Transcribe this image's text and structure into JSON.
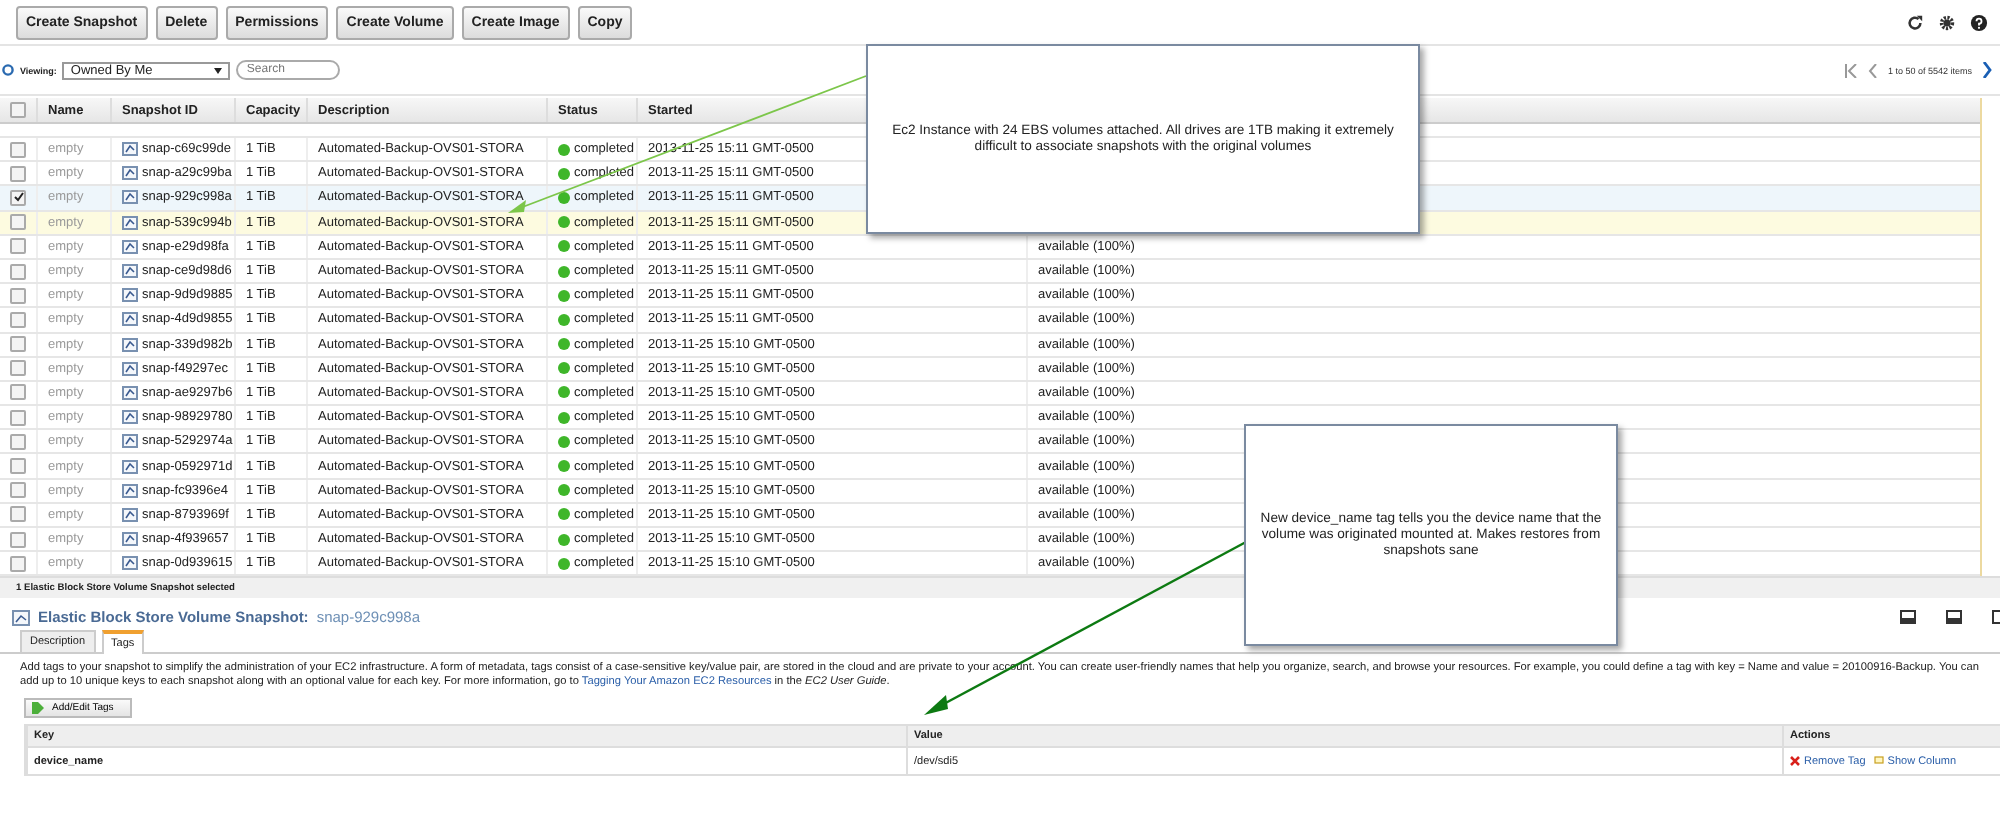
{
  "toolbar": {
    "buttons": [
      "Create Snapshot",
      "Delete",
      "Permissions",
      "Create Volume",
      "Create Image",
      "Copy"
    ]
  },
  "filter": {
    "label": "Viewing:",
    "value": "Owned By Me",
    "search_placeholder": "Search"
  },
  "pagination": {
    "text": "1 to 50 of 5542 items"
  },
  "table": {
    "all_checked": false,
    "columns": [
      "Name",
      "Snapshot ID",
      "Capacity",
      "Description",
      "Status",
      "Started"
    ],
    "rows": [
      {
        "checked": false,
        "hovered": false,
        "name": "empty",
        "id": "snap-c69c99de",
        "capacity": "1 TiB",
        "description": "Automated-Backup-OVS01-STORA",
        "status": "completed",
        "started": "2013-11-25 15:11 GMT-0500"
      },
      {
        "checked": false,
        "hovered": false,
        "name": "empty",
        "id": "snap-a29c99ba",
        "capacity": "1 TiB",
        "description": "Automated-Backup-OVS01-STORA",
        "status": "completed",
        "started": "2013-11-25 15:11 GMT-0500"
      },
      {
        "checked": true,
        "hovered": false,
        "name": "empty",
        "id": "snap-929c998a",
        "capacity": "1 TiB",
        "description": "Automated-Backup-OVS01-STORA",
        "status": "completed",
        "started": "2013-11-25 15:11 GMT-0500"
      },
      {
        "checked": false,
        "hovered": true,
        "name": "empty",
        "id": "snap-539c994b",
        "capacity": "1 TiB",
        "description": "Automated-Backup-OVS01-STORA",
        "status": "completed",
        "started": "2013-11-25 15:11 GMT-0500"
      },
      {
        "checked": false,
        "hovered": false,
        "name": "empty",
        "id": "snap-e29d98fa",
        "capacity": "1 TiB",
        "description": "Automated-Backup-OVS01-STORA",
        "status": "completed",
        "started": "2013-11-25 15:11 GMT-0500",
        "progress": "available (100%)"
      },
      {
        "checked": false,
        "hovered": false,
        "name": "empty",
        "id": "snap-ce9d98d6",
        "capacity": "1 TiB",
        "description": "Automated-Backup-OVS01-STORA",
        "status": "completed",
        "started": "2013-11-25 15:11 GMT-0500",
        "progress": "available (100%)"
      },
      {
        "checked": false,
        "hovered": false,
        "name": "empty",
        "id": "snap-9d9d9885",
        "capacity": "1 TiB",
        "description": "Automated-Backup-OVS01-STORA",
        "status": "completed",
        "started": "2013-11-25 15:11 GMT-0500",
        "progress": "available (100%)"
      },
      {
        "checked": false,
        "hovered": false,
        "name": "empty",
        "id": "snap-4d9d9855",
        "capacity": "1 TiB",
        "description": "Automated-Backup-OVS01-STORA",
        "status": "completed",
        "started": "2013-11-25 15:11 GMT-0500",
        "progress": "available (100%)"
      },
      {
        "checked": false,
        "hovered": false,
        "name": "empty",
        "id": "snap-339d982b",
        "capacity": "1 TiB",
        "description": "Automated-Backup-OVS01-STORA",
        "status": "completed",
        "started": "2013-11-25 15:10 GMT-0500",
        "progress": "available (100%)"
      },
      {
        "checked": false,
        "hovered": false,
        "name": "empty",
        "id": "snap-f49297ec",
        "capacity": "1 TiB",
        "description": "Automated-Backup-OVS01-STORA",
        "status": "completed",
        "started": "2013-11-25 15:10 GMT-0500",
        "progress": "available (100%)"
      },
      {
        "checked": false,
        "hovered": false,
        "name": "empty",
        "id": "snap-ae9297b6",
        "capacity": "1 TiB",
        "description": "Automated-Backup-OVS01-STORA",
        "status": "completed",
        "started": "2013-11-25 15:10 GMT-0500",
        "progress": "available (100%)"
      },
      {
        "checked": false,
        "hovered": false,
        "name": "empty",
        "id": "snap-98929780",
        "capacity": "1 TiB",
        "description": "Automated-Backup-OVS01-STORA",
        "status": "completed",
        "started": "2013-11-25 15:10 GMT-0500",
        "progress": "available (100%)"
      },
      {
        "checked": false,
        "hovered": false,
        "name": "empty",
        "id": "snap-5292974a",
        "capacity": "1 TiB",
        "description": "Automated-Backup-OVS01-STORA",
        "status": "completed",
        "started": "2013-11-25 15:10 GMT-0500",
        "progress": "available (100%)"
      },
      {
        "checked": false,
        "hovered": false,
        "name": "empty",
        "id": "snap-0592971d",
        "capacity": "1 TiB",
        "description": "Automated-Backup-OVS01-STORA",
        "status": "completed",
        "started": "2013-11-25 15:10 GMT-0500",
        "progress": "available (100%)"
      },
      {
        "checked": false,
        "hovered": false,
        "name": "empty",
        "id": "snap-fc9396e4",
        "capacity": "1 TiB",
        "description": "Automated-Backup-OVS01-STORA",
        "status": "completed",
        "started": "2013-11-25 15:10 GMT-0500",
        "progress": "available (100%)"
      },
      {
        "checked": false,
        "hovered": false,
        "name": "empty",
        "id": "snap-8793969f",
        "capacity": "1 TiB",
        "description": "Automated-Backup-OVS01-STORA",
        "status": "completed",
        "started": "2013-11-25 15:10 GMT-0500",
        "progress": "available (100%)"
      },
      {
        "checked": false,
        "hovered": false,
        "name": "empty",
        "id": "snap-4f939657",
        "capacity": "1 TiB",
        "description": "Automated-Backup-OVS01-STORA",
        "status": "completed",
        "started": "2013-11-25 15:10 GMT-0500",
        "progress": "available (100%)"
      },
      {
        "checked": false,
        "hovered": false,
        "name": "empty",
        "id": "snap-0d939615",
        "capacity": "1 TiB",
        "description": "Automated-Backup-OVS01-STORA",
        "status": "completed",
        "started": "2013-11-25 15:10 GMT-0500",
        "progress": "available (100%)"
      }
    ]
  },
  "status_bar": "1 Elastic Block Store Volume Snapshot selected",
  "details": {
    "title": "Elastic Block Store Volume Snapshot:",
    "snapshot_id": "snap-929c998a",
    "tabs": [
      {
        "label": "Description",
        "selected": false
      },
      {
        "label": "Tags",
        "selected": true
      }
    ],
    "help_text": {
      "before": "Add tags to your snapshot to simplify the administration of your EC2 infrastructure. A form of metadata, tags consist of a case-sensitive key/value pair, are stored in the cloud and are private to your account. You can create user-friendly names that help you organize, search, and browse your resources. For example, you could define a tag with key = Name and value = 20100916-Backup. You can add up to 10 unique keys to each snapshot along with an optional value for each key. For more information, go to ",
      "link": "Tagging Your Amazon EC2 Resources",
      "after": " in the *EC2 User Guide*."
    },
    "add_button": "Add/Edit Tags",
    "tags_table": {
      "columns": [
        "Key",
        "Value",
        "Actions"
      ],
      "rows": [
        {
          "key": "device_name",
          "value": "/dev/sdi5",
          "actions": [
            {
              "kind": "remove",
              "label": "Remove Tag"
            },
            {
              "kind": "show",
              "label": "Show Column"
            }
          ]
        }
      ]
    }
  },
  "callouts": [
    {
      "text": "Ec2 Instance with 24 EBS volumes attached. All drives are 1TB making it extremely difficult to associate snapshots with the original volumes"
    },
    {
      "text": "New device_name tag tells you the device name that the volume was originated mounted at. Makes restores from snapshots sane"
    }
  ]
}
